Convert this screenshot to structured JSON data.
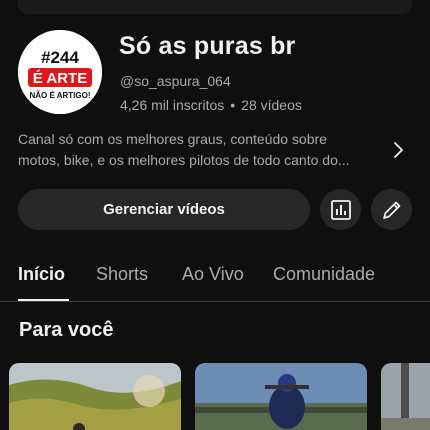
{
  "channel": {
    "name": "Só as puras br",
    "handle": "@so_aspura_064",
    "subscribers": "4,26 mil inscritos",
    "separator": "•",
    "videos": "28 vídeos",
    "avatar_text": {
      "top": "#244",
      "middle": "É ARTE",
      "bottom": "NÃO É ARTIGO!"
    },
    "description_lines": [
      "Canal só com os melhores graus, conteúdo sobre",
      "motos, bike, e os melhores pilotos de todo canto do..."
    ]
  },
  "actions": {
    "manage_label": "Gerenciar vídeos",
    "stats_icon": "analytics-icon",
    "edit_icon": "pencil-icon"
  },
  "tabs": [
    {
      "label": "Início",
      "active": true
    },
    {
      "label": "Shorts",
      "active": false
    },
    {
      "label": "Ao Vivo",
      "active": false
    },
    {
      "label": "Comunidade",
      "active": false
    }
  ],
  "section": {
    "title": "Para você"
  },
  "colors": {
    "background": "#0f0f0f",
    "button": "#272727",
    "text_primary": "#f1f1f1",
    "text_secondary": "#aaaaaa",
    "avatar_red": "#e0161b"
  }
}
